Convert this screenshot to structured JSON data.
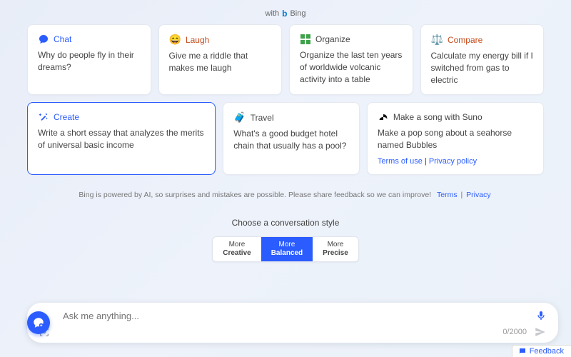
{
  "header": {
    "with_text": "with",
    "brand": "Bing"
  },
  "cards": {
    "chat": {
      "title": "Chat",
      "body": "Why do people fly in their dreams?"
    },
    "laugh": {
      "title": "Laugh",
      "body": "Give me a riddle that makes me laugh"
    },
    "organize": {
      "title": "Organize",
      "body": "Organize the last ten years of worldwide volcanic activity into a table"
    },
    "compare": {
      "title": "Compare",
      "body": "Calculate my energy bill if I switched from gas to electric"
    },
    "create": {
      "title": "Create",
      "body": "Write a short essay that analyzes the merits of universal basic income"
    },
    "travel": {
      "title": "Travel",
      "body": "What's a good budget hotel chain that usually has a pool?"
    },
    "suno": {
      "title": "Make a song with Suno",
      "body": "Make a pop song about a seahorse named Bubbles",
      "links": {
        "terms": "Terms of use",
        "sep": " | ",
        "privacy": "Privacy policy"
      }
    }
  },
  "disclaimer": {
    "text": "Bing is powered by AI, so surprises and mistakes are possible. Please share feedback so we can improve!",
    "terms": "Terms",
    "privacy": "Privacy"
  },
  "style": {
    "label": "Choose a conversation style",
    "options": [
      {
        "line1": "More",
        "line2": "Creative"
      },
      {
        "line1": "More",
        "line2": "Balanced"
      },
      {
        "line1": "More",
        "line2": "Precise"
      }
    ],
    "active_index": 1
  },
  "input": {
    "placeholder": "Ask me anything...",
    "counter": "0/2000"
  },
  "feedback": {
    "label": "Feedback"
  }
}
